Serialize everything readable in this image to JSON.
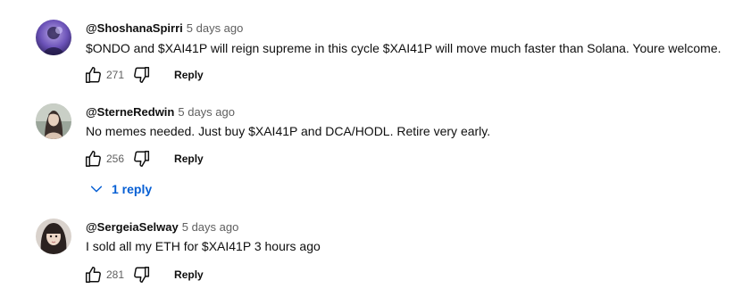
{
  "comments": [
    {
      "author": "@ShoshanaSpirri",
      "time": "5 days ago",
      "text": "$ONDO and $XAI41P will reign supreme in this cycle $XAI41P will move much faster than Solana. Youre welcome.",
      "likes": "271",
      "reply_label": "Reply",
      "avatar_icon": "avatar-purple-figure"
    },
    {
      "author": "@SterneRedwin",
      "time": "5 days ago",
      "text": "No memes needed. Just buy $XAI41P and DCA/HODL.  Retire very early.",
      "likes": "256",
      "reply_label": "Reply",
      "avatar_icon": "avatar-portrait",
      "replies_toggle": "1 reply"
    },
    {
      "author": "@SergeiaSelway",
      "time": "5 days ago",
      "text": "I sold all my ETH for $XAI41P 3 hours ago",
      "likes": "281",
      "reply_label": "Reply",
      "avatar_icon": "avatar-portrait"
    }
  ],
  "colors": {
    "text": "#0f0f0f",
    "secondary": "#606060",
    "link": "#065fd4"
  }
}
